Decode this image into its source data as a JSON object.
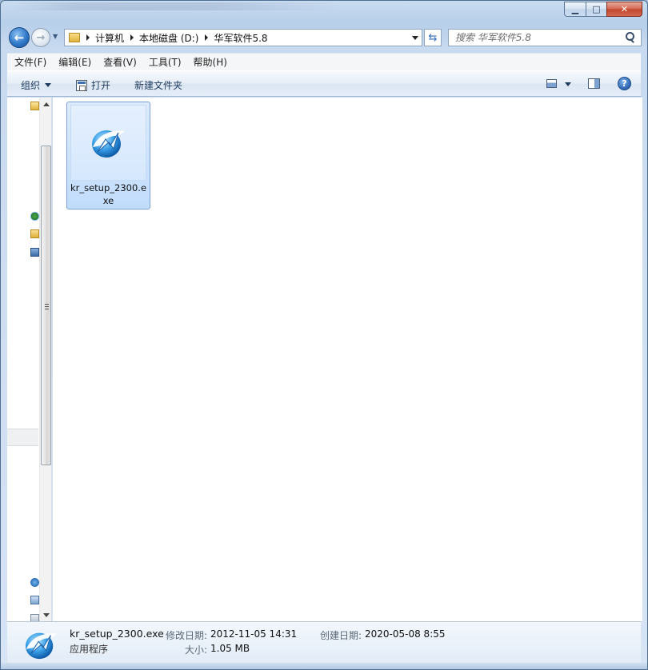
{
  "breadcrumb": {
    "items": [
      "计算机",
      "本地磁盘 (D:)",
      "华军软件5.8"
    ]
  },
  "search": {
    "placeholder": "搜索 华军软件5.8"
  },
  "menubar": {
    "items": [
      "文件(F)",
      "编辑(E)",
      "查看(V)",
      "工具(T)",
      "帮助(H)"
    ]
  },
  "toolbar": {
    "organize_label": "组织",
    "open_label": "打开",
    "new_folder_label": "新建文件夹"
  },
  "icons": {
    "back": "back-arrow-icon",
    "forward": "forward-arrow-icon",
    "refresh": "refresh-icon",
    "search": "search-icon",
    "help": "help-icon",
    "views": "change-view-icon",
    "preview": "preview-pane-icon",
    "app": "setup-program-icon"
  },
  "files": [
    {
      "name": "kr_setup_2300.exe",
      "selected": true
    }
  ],
  "details": {
    "name": "kr_setup_2300.exe",
    "type": "应用程序",
    "modified_label": "修改日期:",
    "modified_value": "2012-11-05 14:31",
    "created_label": "创建日期:",
    "created_value": "2020-05-08 8:55",
    "size_label": "大小:",
    "size_value": "1.05 MB"
  },
  "colors": {
    "selection_fill": "#c1dcfc",
    "selection_border": "#7da2ce",
    "window_frame": "#b7cfea",
    "close_button": "#c1452c"
  }
}
